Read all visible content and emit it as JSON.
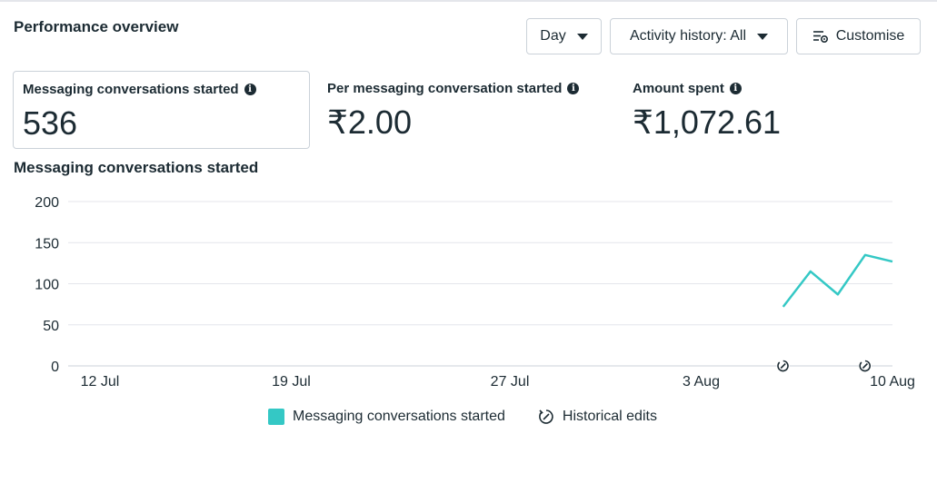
{
  "header": {
    "title": "Performance overview"
  },
  "controls": {
    "day_label": "Day",
    "activity_label": "Activity history: All",
    "customise_label": "Customise"
  },
  "metrics": [
    {
      "label": "Messaging conversations started",
      "value": "536"
    },
    {
      "label": "Per messaging conversation started",
      "value": "₹2.00"
    },
    {
      "label": "Amount spent",
      "value": "₹1,072.61"
    }
  ],
  "chart": {
    "title": "Messaging conversations started"
  },
  "legend": {
    "series_label": "Messaging conversations started",
    "edits_label": "Historical edits"
  },
  "colors": {
    "series": "#34c8c5",
    "grid": "#e4e6eb",
    "text": "#1c2b33"
  },
  "chart_data": {
    "type": "line",
    "title": "Messaging conversations started",
    "ylim": [
      0,
      200
    ],
    "yticks": [
      0,
      50,
      100,
      150,
      200
    ],
    "xlabels": [
      "12 Jul",
      "19 Jul",
      "27 Jul",
      "3 Aug",
      "10 Aug"
    ],
    "x": [
      "2024-08-06",
      "2024-08-07",
      "2024-08-08",
      "2024-08-09",
      "2024-08-10"
    ],
    "series": [
      {
        "name": "Messaging conversations started",
        "values": [
          72,
          115,
          87,
          135,
          127
        ]
      }
    ],
    "historical_edit_markers": [
      "2024-08-06",
      "2024-08-09"
    ],
    "grid": true,
    "legend_position": "bottom"
  }
}
